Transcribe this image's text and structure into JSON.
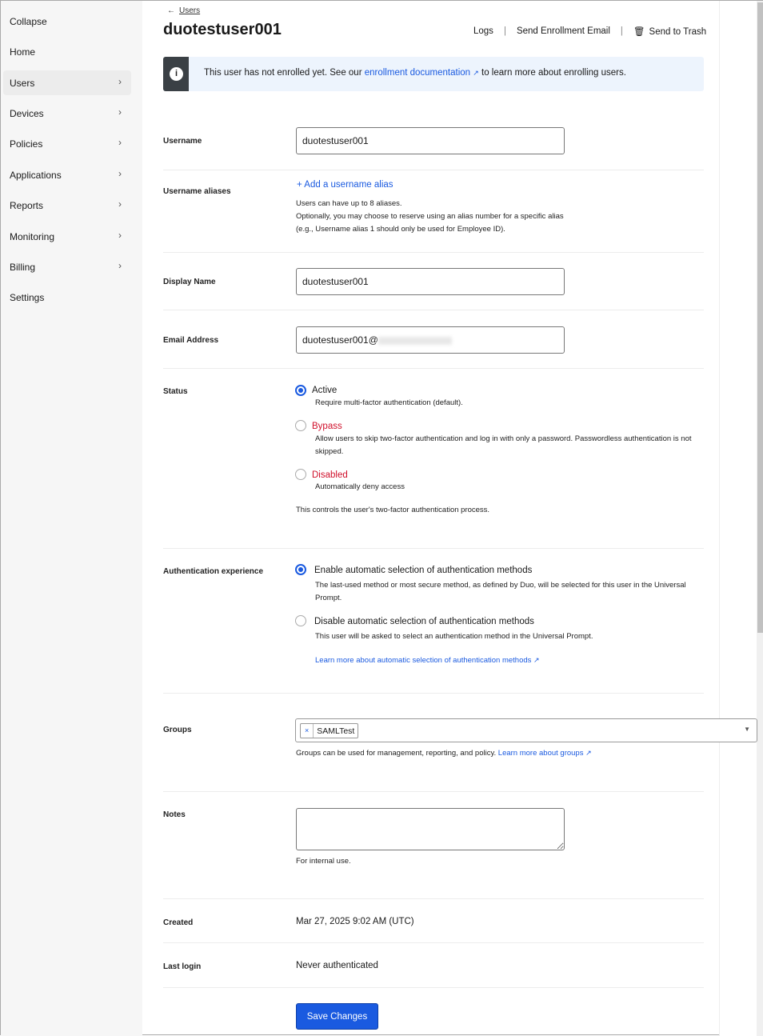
{
  "sidebar": {
    "collapse": "Collapse",
    "items": [
      {
        "label": "Home"
      },
      {
        "label": "Users"
      },
      {
        "label": "Devices"
      },
      {
        "label": "Policies"
      },
      {
        "label": "Applications"
      },
      {
        "label": "Reports"
      },
      {
        "label": "Monitoring"
      },
      {
        "label": "Billing"
      },
      {
        "label": "Settings"
      }
    ]
  },
  "header": {
    "back": "Users",
    "title": "duotestuser001",
    "logs": "Logs",
    "send_email": "Send Enrollment Email",
    "trash": "Send to Trash"
  },
  "banner": {
    "pre": "This user has not enrolled yet. See our ",
    "link": "enrollment documentation",
    "post": " to learn more about enrolling users."
  },
  "form": {
    "username": {
      "label": "Username",
      "value": "duotestuser001"
    },
    "aliases": {
      "label": "Username aliases",
      "add": "Add a username alias",
      "help1": "Users can have up to 8 aliases.",
      "help2": "Optionally, you may choose to reserve using an alias number for a specific alias",
      "help3": "(e.g., Username alias 1 should only be used for Employee ID)."
    },
    "display": {
      "label": "Display Name",
      "value": "duotestuser001"
    },
    "email": {
      "label": "Email Address",
      "value": "duotestuser001@"
    },
    "status": {
      "label": "Status",
      "options": [
        {
          "label": "Active",
          "desc": "Require multi-factor authentication (default).",
          "selected": true
        },
        {
          "label": "Bypass",
          "desc": "Allow users to skip two-factor authentication and log in with only a password. Passwordless authentication is not skipped.",
          "selected": false
        },
        {
          "label": "Disabled",
          "desc": "Automatically deny access",
          "selected": false
        }
      ],
      "help": "This controls the user's two-factor authentication process."
    },
    "auth": {
      "label": "Authentication experience",
      "options": [
        {
          "label": "Enable automatic selection of authentication methods",
          "desc": "The last-used method or most secure method, as defined by Duo, will be selected for this user in the Universal Prompt.",
          "selected": true
        },
        {
          "label": "Disable automatic selection of authentication methods",
          "desc": "This user will be asked to select an authentication method in the Universal Prompt.",
          "selected": false
        }
      ],
      "link": "Learn more about automatic selection of authentication methods"
    },
    "groups": {
      "label": "Groups",
      "tags": [
        "SAMLTest"
      ],
      "help": "Groups can be used for management, reporting, and policy. ",
      "link": "Learn more about groups"
    },
    "notes": {
      "label": "Notes",
      "value": "",
      "help": "For internal use."
    },
    "created": {
      "label": "Created",
      "value": "Mar 27, 2025 9:02 AM (UTC)"
    },
    "last_login": {
      "label": "Last login",
      "value": "Never authenticated"
    },
    "save": "Save Changes"
  },
  "colors": {
    "accent": "#1a5ae0",
    "danger": "#d0102b",
    "banner_bg": "#edf4fd"
  }
}
